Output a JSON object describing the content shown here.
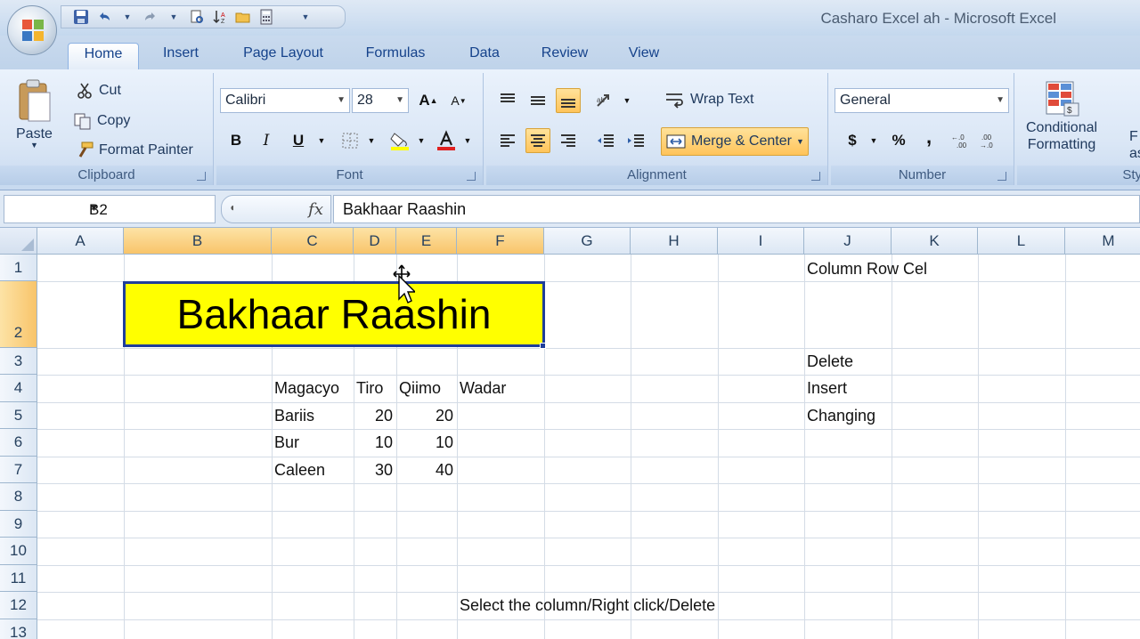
{
  "window": {
    "title": "Casharo Excel ah - Microsoft Excel"
  },
  "tabs": [
    "Home",
    "Insert",
    "Page Layout",
    "Formulas",
    "Data",
    "Review",
    "View"
  ],
  "active_tab": "Home",
  "ribbon": {
    "clipboard": {
      "paste": "Paste",
      "cut": "Cut",
      "copy": "Copy",
      "format_painter": "Format Painter",
      "label": "Clipboard"
    },
    "font": {
      "name": "Calibri",
      "size": "28",
      "bold": "B",
      "italic": "I",
      "underline": "U",
      "label": "Font",
      "grow": "A",
      "shrink": "A"
    },
    "alignment": {
      "wrap_text": "Wrap Text",
      "merge_center": "Merge & Center",
      "label": "Alignment"
    },
    "number": {
      "format": "General",
      "currency": "$",
      "percent": "%",
      "comma": ",",
      "label": "Number"
    },
    "styles": {
      "conditional_line1": "Conditional",
      "conditional_line2": "Formatting",
      "partial_f": "F",
      "partial_as": "as",
      "label": "Sty"
    }
  },
  "formula_bar": {
    "name_box": "B2",
    "fx": "fx",
    "content": "Bakhaar Raashin"
  },
  "grid": {
    "columns": [
      "A",
      "B",
      "C",
      "D",
      "E",
      "F",
      "G",
      "H",
      "I",
      "J",
      "K",
      "L",
      "M"
    ],
    "selected_columns": [
      "B",
      "C",
      "D",
      "E",
      "F"
    ],
    "rows": [
      "1",
      "2",
      "3",
      "4",
      "5",
      "6",
      "7",
      "8",
      "9",
      "10",
      "11",
      "12",
      "13"
    ],
    "selected_rows": [
      "2"
    ],
    "merged_title": "Bakhaar Raashin",
    "table": {
      "headers": [
        "Magacyo",
        "Tiro",
        "Qiimo",
        "Wadar"
      ],
      "rows": [
        {
          "name": "Bariis",
          "tiro": "20",
          "qiimo": "20"
        },
        {
          "name": "Bur",
          "tiro": "10",
          "qiimo": "10"
        },
        {
          "name": "Caleen",
          "tiro": "30",
          "qiimo": "40"
        }
      ]
    },
    "notes": {
      "j1": "Column Row Cel",
      "j3": "Delete",
      "j4": "Insert",
      "j5": "Changing",
      "f12": "Select the column/Right click/Delete"
    }
  }
}
